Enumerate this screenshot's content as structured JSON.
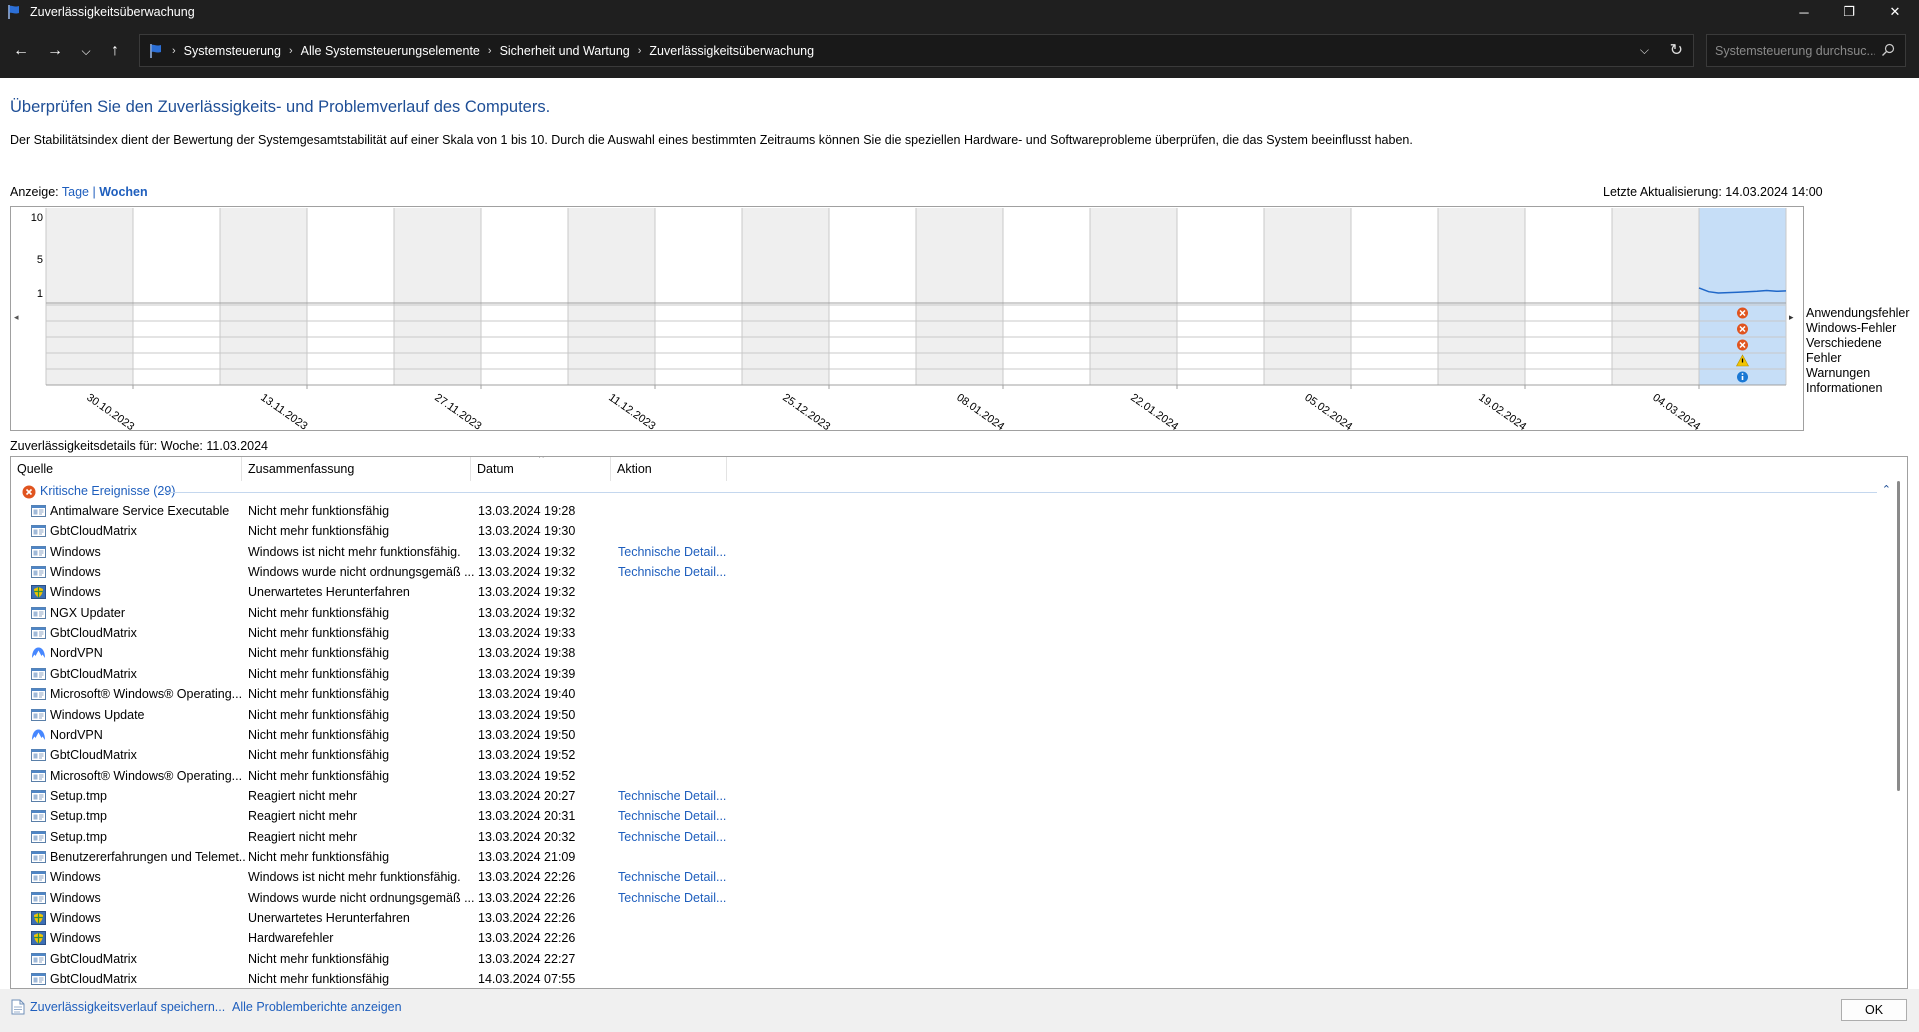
{
  "window": {
    "title": "Zuverlässigkeitsüberwachung"
  },
  "titlebar": {
    "minimize": "─",
    "maximize": "❐",
    "close": "✕"
  },
  "nav": {
    "back": "←",
    "forward": "→",
    "recent": "⌵",
    "up": "↑"
  },
  "address": {
    "crumbs": [
      "Systemsteuerung",
      "Alle Systemsteuerungselemente",
      "Sicherheit und Wartung",
      "Zuverlässigkeitsüberwachung"
    ],
    "separator": "›",
    "dropdown": "⌵",
    "refresh": "↻"
  },
  "search": {
    "placeholder": "Systemsteuerung durchsuc..."
  },
  "page": {
    "heading": "Überprüfen Sie den Zuverlässigkeits- und Problemverlauf des Computers.",
    "description": "Der Stabilitätsindex dient der Bewertung der Systemgesamtstabilität auf einer Skala von 1 bis 10. Durch die Auswahl eines bestimmten Zeitraums können Sie die speziellen Hardware- und Softwareprobleme überprüfen, die das System beeinflusst haben.",
    "view_label": "Anzeige:",
    "view_days": "Tage",
    "view_sep": "|",
    "view_weeks": "Wochen",
    "last_update": "Letzte Aktualisierung: 14.03.2024 14:00",
    "details_label": "Zuverlässigkeitsdetails für: Woche: 11.03.2024"
  },
  "chart_data": {
    "type": "line",
    "title": "",
    "ylabel": "",
    "ylim": [
      1,
      10
    ],
    "yticks": [
      "10",
      "5",
      "1"
    ],
    "x": [
      "30.10.2023",
      "13.11.2023",
      "27.11.2023",
      "11.12.2023",
      "25.12.2023",
      "08.01.2024",
      "22.01.2024",
      "05.02.2024",
      "19.02.2024",
      "04.03.2024"
    ],
    "columns": 20,
    "selected_column": 19,
    "series": [
      {
        "values": [
          1.6,
          1.15,
          1.0,
          1.05,
          1.1,
          1.15,
          1.2,
          1.3,
          1.2,
          1.25
        ]
      }
    ],
    "event_rows": [
      "Anwendungsfehler",
      "Windows-Fehler",
      "Verschiedene Fehler",
      "Warnungen",
      "Informationen"
    ],
    "event_markers": [
      {
        "row": "Anwendungsfehler",
        "column": 19,
        "kind": "error"
      },
      {
        "row": "Windows-Fehler",
        "column": 19,
        "kind": "error"
      },
      {
        "row": "Verschiedene Fehler",
        "column": 19,
        "kind": "error"
      },
      {
        "row": "Warnungen",
        "column": 19,
        "kind": "warning"
      },
      {
        "row": "Informationen",
        "column": 19,
        "kind": "info"
      }
    ],
    "colors": {
      "line": "#1f67c8",
      "selected": "#c6def7",
      "shaded": "#efefef",
      "error": "#e0541f",
      "warning": "#f2c400",
      "info": "#1a78d4"
    }
  },
  "scroll": {
    "left": "◂",
    "right": "▸"
  },
  "table": {
    "columns": [
      "Quelle",
      "Zusammenfassung",
      "Datum",
      "Aktion"
    ],
    "sort_caret": "^",
    "group": {
      "label": "Kritische Ereignisse (29)",
      "collapse": "⌃"
    },
    "rows": [
      {
        "icon": "app",
        "source": "Antimalware Service Executable",
        "summary": "Nicht mehr funktionsfähig",
        "date": "13.03.2024 19:28",
        "action": ""
      },
      {
        "icon": "app",
        "source": "GbtCloudMatrix",
        "summary": "Nicht mehr funktionsfähig",
        "date": "13.03.2024 19:30",
        "action": ""
      },
      {
        "icon": "app",
        "source": "Windows",
        "summary": "Windows ist nicht mehr funktionsfähig.",
        "date": "13.03.2024 19:32",
        "action": "Technische Detail..."
      },
      {
        "icon": "app",
        "source": "Windows",
        "summary": "Windows wurde nicht ordnungsgemäß ...",
        "date": "13.03.2024 19:32",
        "action": "Technische Detail..."
      },
      {
        "icon": "shield",
        "source": "Windows",
        "summary": "Unerwartetes Herunterfahren",
        "date": "13.03.2024 19:32",
        "action": ""
      },
      {
        "icon": "app",
        "source": "NGX Updater",
        "summary": "Nicht mehr funktionsfähig",
        "date": "13.03.2024 19:32",
        "action": ""
      },
      {
        "icon": "app",
        "source": "GbtCloudMatrix",
        "summary": "Nicht mehr funktionsfähig",
        "date": "13.03.2024 19:33",
        "action": ""
      },
      {
        "icon": "nordvpn",
        "source": "NordVPN",
        "summary": "Nicht mehr funktionsfähig",
        "date": "13.03.2024 19:38",
        "action": ""
      },
      {
        "icon": "app",
        "source": "GbtCloudMatrix",
        "summary": "Nicht mehr funktionsfähig",
        "date": "13.03.2024 19:39",
        "action": ""
      },
      {
        "icon": "app",
        "source": "Microsoft® Windows® Operating...",
        "summary": "Nicht mehr funktionsfähig",
        "date": "13.03.2024 19:40",
        "action": ""
      },
      {
        "icon": "app",
        "source": "Windows Update",
        "summary": "Nicht mehr funktionsfähig",
        "date": "13.03.2024 19:50",
        "action": ""
      },
      {
        "icon": "nordvpn",
        "source": "NordVPN",
        "summary": "Nicht mehr funktionsfähig",
        "date": "13.03.2024 19:50",
        "action": ""
      },
      {
        "icon": "app",
        "source": "GbtCloudMatrix",
        "summary": "Nicht mehr funktionsfähig",
        "date": "13.03.2024 19:52",
        "action": ""
      },
      {
        "icon": "app",
        "source": "Microsoft® Windows® Operating...",
        "summary": "Nicht mehr funktionsfähig",
        "date": "13.03.2024 19:52",
        "action": ""
      },
      {
        "icon": "app",
        "source": "Setup.tmp",
        "summary": "Reagiert nicht mehr",
        "date": "13.03.2024 20:27",
        "action": "Technische Detail..."
      },
      {
        "icon": "app",
        "source": "Setup.tmp",
        "summary": "Reagiert nicht mehr",
        "date": "13.03.2024 20:31",
        "action": "Technische Detail..."
      },
      {
        "icon": "app",
        "source": "Setup.tmp",
        "summary": "Reagiert nicht mehr",
        "date": "13.03.2024 20:32",
        "action": "Technische Detail..."
      },
      {
        "icon": "app",
        "source": "Benutzererfahrungen und Telemet...",
        "summary": "Nicht mehr funktionsfähig",
        "date": "13.03.2024 21:09",
        "action": ""
      },
      {
        "icon": "app",
        "source": "Windows",
        "summary": "Windows ist nicht mehr funktionsfähig.",
        "date": "13.03.2024 22:26",
        "action": "Technische Detail..."
      },
      {
        "icon": "app",
        "source": "Windows",
        "summary": "Windows wurde nicht ordnungsgemäß ...",
        "date": "13.03.2024 22:26",
        "action": "Technische Detail..."
      },
      {
        "icon": "shield",
        "source": "Windows",
        "summary": "Unerwartetes Herunterfahren",
        "date": "13.03.2024 22:26",
        "action": ""
      },
      {
        "icon": "shield",
        "source": "Windows",
        "summary": "Hardwarefehler",
        "date": "13.03.2024 22:26",
        "action": ""
      },
      {
        "icon": "app",
        "source": "GbtCloudMatrix",
        "summary": "Nicht mehr funktionsfähig",
        "date": "13.03.2024 22:27",
        "action": ""
      },
      {
        "icon": "app",
        "source": "GbtCloudMatrix",
        "summary": "Nicht mehr funktionsfähig",
        "date": "14.03.2024 07:55",
        "action": ""
      }
    ]
  },
  "footer": {
    "save_link": "Zuverlässigkeitsverlauf speichern...",
    "reports_link": "Alle Problemberichte anzeigen",
    "ok": "OK"
  }
}
